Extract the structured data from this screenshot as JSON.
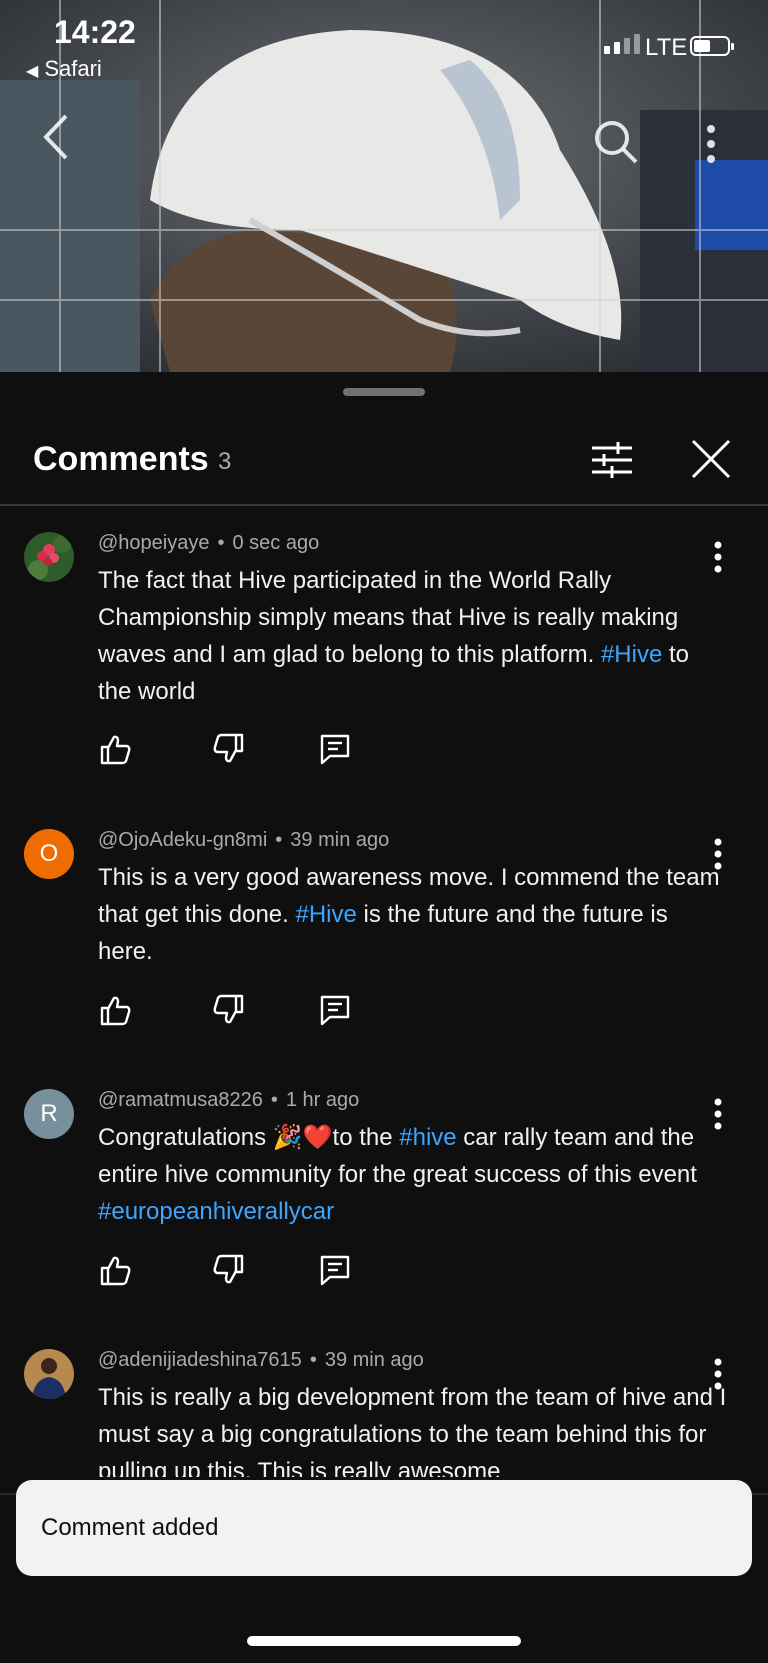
{
  "status_bar": {
    "time": "14:22",
    "back_app": "Safari",
    "network": "LTE"
  },
  "video": {
    "icons": [
      "chevron-left-icon",
      "search-icon",
      "more-vertical-icon"
    ]
  },
  "comments_panel": {
    "title": "Comments",
    "count": "3",
    "comments": [
      {
        "author": "@hopeiyaye",
        "time": "0 sec ago",
        "text_before": "The fact that Hive participated in the World Rally Championship simply means that Hive is really making waves and I am glad to belong to this platform. ",
        "tag": "#Hive",
        "text_after": " to the world"
      },
      {
        "author": "@OjoAdeku-gn8mi",
        "time": "39 min ago",
        "avatar_letter": "O",
        "text_before": "This is a very good awareness move. I commend the team that get this done. ",
        "tag": "#Hive",
        "text_after": " is the future and the future is here."
      },
      {
        "author": "@ramatmusa8226",
        "time": "1 hr ago",
        "avatar_letter": "R",
        "text_before": "Congratulations 🎉❤️to the ",
        "tag": "#hive",
        "text_middle": " car rally  team and the entire hive community for the great success of this event ",
        "tag2": "#europeanhiverallycar"
      },
      {
        "author": "@adenijiadeshina7615",
        "time": "39 min ago",
        "text_before": "This is really a big development from the team of hive and I must say a big congratulations to the team behind this for pulling up this. This is really awesome"
      }
    ]
  },
  "toast": {
    "message": "Comment added"
  },
  "colors": {
    "background": "#0f0f0f",
    "link": "#3ea6ff",
    "avatar_o": "#ef6c00",
    "avatar_r": "#78909c"
  }
}
